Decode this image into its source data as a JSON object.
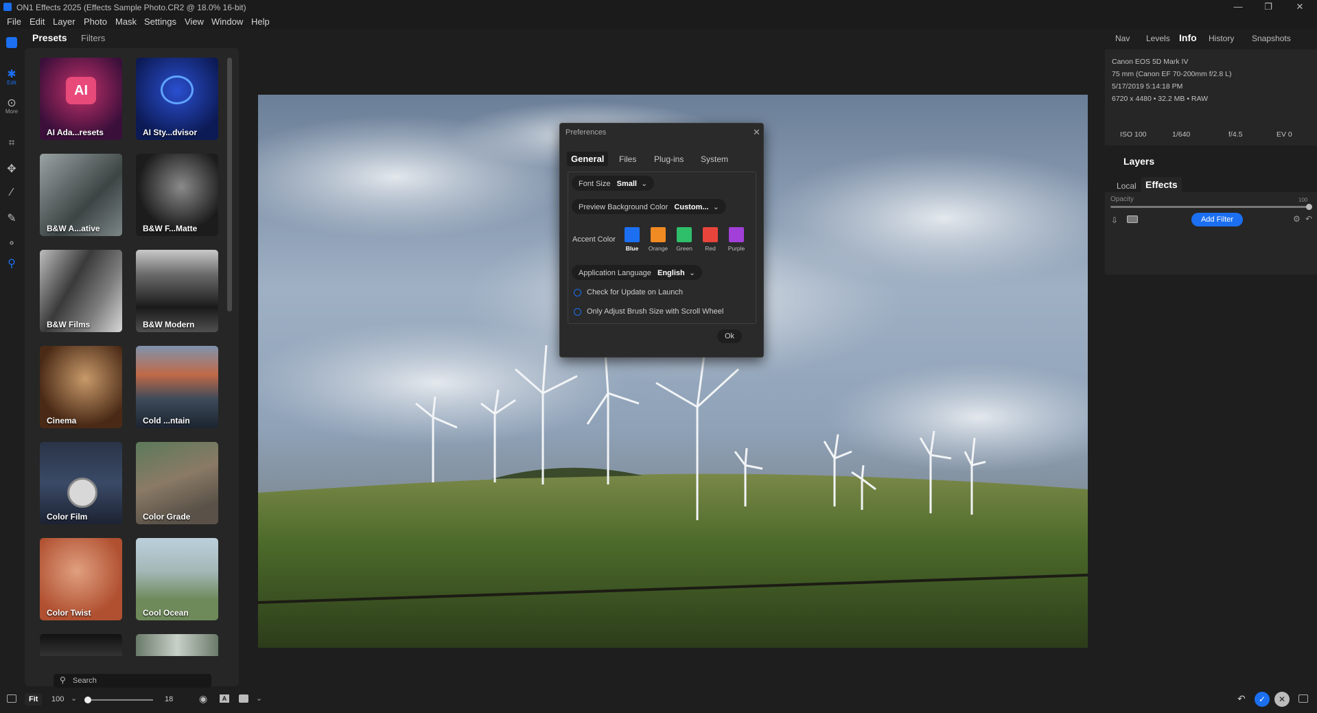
{
  "window": {
    "title": "ON1 Effects 2025 (Effects Sample Photo.CR2 @ 18.0% 16-bit)"
  },
  "menu": [
    "File",
    "Edit",
    "Layer",
    "Photo",
    "Mask",
    "Settings",
    "View",
    "Window",
    "Help"
  ],
  "toolstrip": {
    "edit_label": "Edit",
    "more_label": "More"
  },
  "left_panel": {
    "tab_presets": "Presets",
    "tab_filters": "Filters",
    "presets": [
      "AI Ada...resets",
      "AI Sty...dvisor",
      "B&W A...ative",
      "B&W F...Matte",
      "B&W Films",
      "B&W Modern",
      "Cinema",
      "Cold ...ntain",
      "Color Film",
      "Color Grade",
      "Color Twist",
      "Cool Ocean"
    ],
    "search_placeholder": "Search"
  },
  "right_panel": {
    "tabs": [
      "Nav",
      "Levels",
      "Info",
      "History",
      "Snapshots"
    ],
    "active_tab": "Info",
    "info": {
      "camera": "Canon EOS 5D Mark IV",
      "lens": "75 mm (Canon EF 70-200mm f/2.8 L)",
      "date": "5/17/2019 5:14:18 PM",
      "dims": "6720 x 4480 • 32.2 MB • RAW",
      "iso": "ISO 100",
      "shutter": "1/640",
      "aperture": "f/4.5",
      "ev": "EV 0"
    },
    "layers_title": "Layers",
    "layer_tabs": [
      "Local",
      "Effects"
    ],
    "opacity_label": "Opacity",
    "opacity_value": "100",
    "add_filter": "Add Filter"
  },
  "dialog": {
    "title": "Preferences",
    "tabs": [
      "General",
      "Files",
      "Plug-ins",
      "System"
    ],
    "font_size_label": "Font Size",
    "font_size_value": "Small",
    "preview_bg_label": "Preview Background Color",
    "preview_bg_value": "Custom...",
    "accent_label": "Accent Color",
    "accents": [
      {
        "name": "Blue",
        "color": "#1b6ff0"
      },
      {
        "name": "Orange",
        "color": "#f08a22"
      },
      {
        "name": "Green",
        "color": "#2fbf6a"
      },
      {
        "name": "Red",
        "color": "#e8443c"
      },
      {
        "name": "Purple",
        "color": "#a23fd8"
      }
    ],
    "language_label": "Application Language",
    "language_value": "English",
    "check_update": "Check for Update on Launch",
    "brush_scroll": "Only Adjust Brush Size with Scroll Wheel",
    "ok": "Ok"
  },
  "statusbar": {
    "fit": "Fit",
    "zoom": "100",
    "slider_value": "18"
  }
}
